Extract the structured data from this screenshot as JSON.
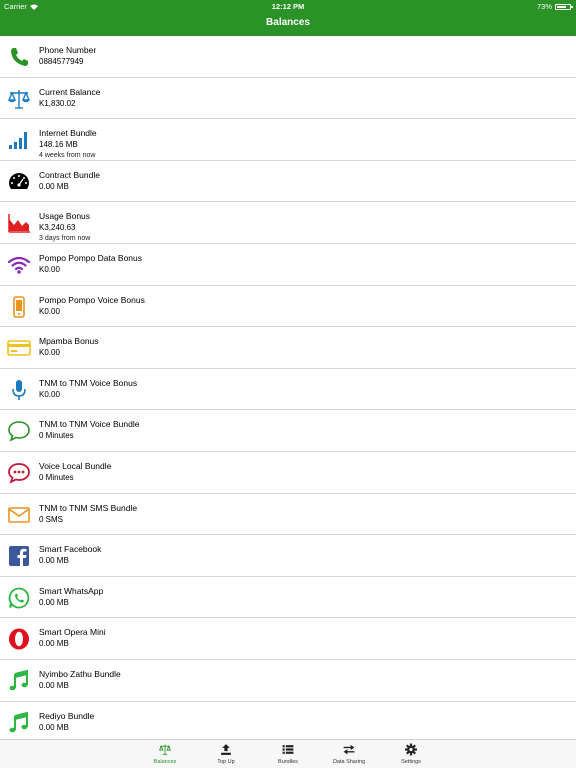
{
  "status_bar": {
    "carrier": "Carrier",
    "time": "12:12 PM",
    "battery": "73%"
  },
  "nav": {
    "title": "Balances"
  },
  "colors": {
    "brand": "#2a9226"
  },
  "items": [
    {
      "icon": "phone-icon",
      "title": "Phone Number",
      "value": "0884577949"
    },
    {
      "icon": "scales-icon",
      "title": "Current Balance",
      "value": "K1,830.02"
    },
    {
      "icon": "signal-bars-icon",
      "title": "Internet Bundle",
      "value": "148.16 MB",
      "sub": "4 weeks from now"
    },
    {
      "icon": "speedometer-icon",
      "title": "Contract Bundle",
      "value": "0.00 MB"
    },
    {
      "icon": "area-chart-icon",
      "title": "Usage Bonus",
      "value": "K3,240.63",
      "sub": "3 days from now"
    },
    {
      "icon": "wifi-icon",
      "title": "Pompo Pompo Data Bonus",
      "value": "K0.00"
    },
    {
      "icon": "mobile-phone-icon",
      "title": "Pompo Pompo Voice Bonus",
      "value": "K0.00"
    },
    {
      "icon": "credit-card-icon",
      "title": "Mpamba Bonus",
      "value": "K0.00"
    },
    {
      "icon": "microphone-icon",
      "title": "TNM to TNM Voice Bonus",
      "value": "K0.00"
    },
    {
      "icon": "speech-bubble-icon",
      "title": "TNM to TNM Voice Bundle",
      "value": "0 Minutes"
    },
    {
      "icon": "chat-dots-icon",
      "title": "Voice Local Bundle",
      "value": "0 Minutes"
    },
    {
      "icon": "envelope-icon",
      "title": "TNM to TNM SMS Bundle",
      "value": "0 SMS"
    },
    {
      "icon": "facebook-icon",
      "title": "Smart Facebook",
      "value": "0.00 MB"
    },
    {
      "icon": "whatsapp-icon",
      "title": "Smart WhatsApp",
      "value": "0.00 MB"
    },
    {
      "icon": "opera-icon",
      "title": "Smart Opera Mini",
      "value": "0.00 MB"
    },
    {
      "icon": "music-note-icon",
      "title": "Nyimbo Zathu Bundle",
      "value": "0.00 MB"
    },
    {
      "icon": "music-note-icon",
      "title": "Rediyo Bundle",
      "value": "0.00 MB"
    }
  ],
  "tabs": [
    {
      "icon": "scales-icon",
      "label": "Balances",
      "active": true
    },
    {
      "icon": "upload-icon",
      "label": "Top Up"
    },
    {
      "icon": "list-icon",
      "label": "Bundles"
    },
    {
      "icon": "transfer-arrows-icon",
      "label": "Data Sharing"
    },
    {
      "icon": "gear-icon",
      "label": "Settings"
    }
  ]
}
